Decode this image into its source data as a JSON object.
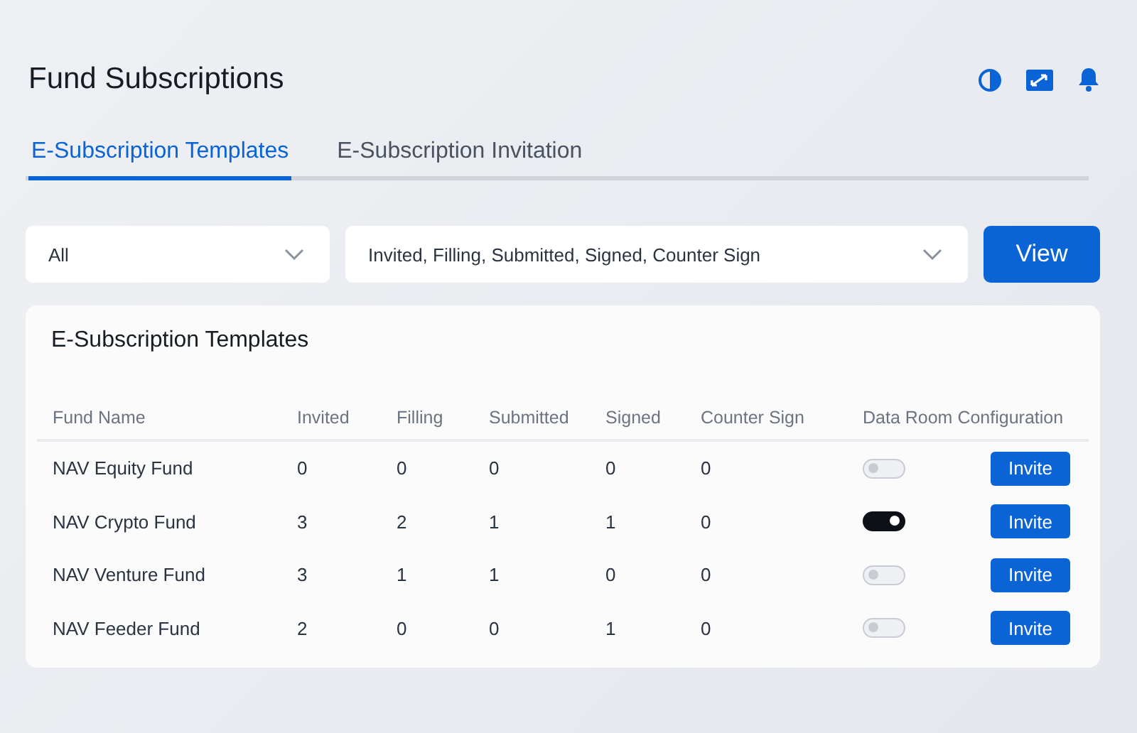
{
  "page": {
    "title": "Fund Subscriptions"
  },
  "tabs": [
    {
      "label": "E-Subscription Templates",
      "selected": true
    },
    {
      "label": "E-Subscription Invitation",
      "selected": false
    }
  ],
  "filters": {
    "fund": "All",
    "statuses": "Invited, Filling, Submitted, Signed, Counter Sign",
    "button": "View"
  },
  "table": {
    "title": "E-Subscription Templates",
    "columns": [
      "Fund Name",
      "Invited",
      "Filling",
      "Submitted",
      "Signed",
      "Counter Sign",
      "Data Room Configuration"
    ],
    "rows": [
      {
        "name": "NAV Equity Fund",
        "invited": "0",
        "filling": "0",
        "submitted": "0",
        "signed": "0",
        "counter_sign": "0",
        "data_room": false,
        "action": "Invite"
      },
      {
        "name": "NAV Crypto Fund",
        "invited": "3",
        "filling": "2",
        "submitted": "1",
        "signed": "1",
        "counter_sign": "0",
        "data_room": true,
        "action": "Invite"
      },
      {
        "name": "NAV Venture Fund",
        "invited": "3",
        "filling": "1",
        "submitted": "1",
        "signed": "0",
        "counter_sign": "0",
        "data_room": false,
        "action": "Invite"
      },
      {
        "name": "NAV Feeder Fund",
        "invited": "2",
        "filling": "0",
        "submitted": "0",
        "signed": "1",
        "counter_sign": "0",
        "data_room": false,
        "action": "Invite"
      }
    ]
  }
}
